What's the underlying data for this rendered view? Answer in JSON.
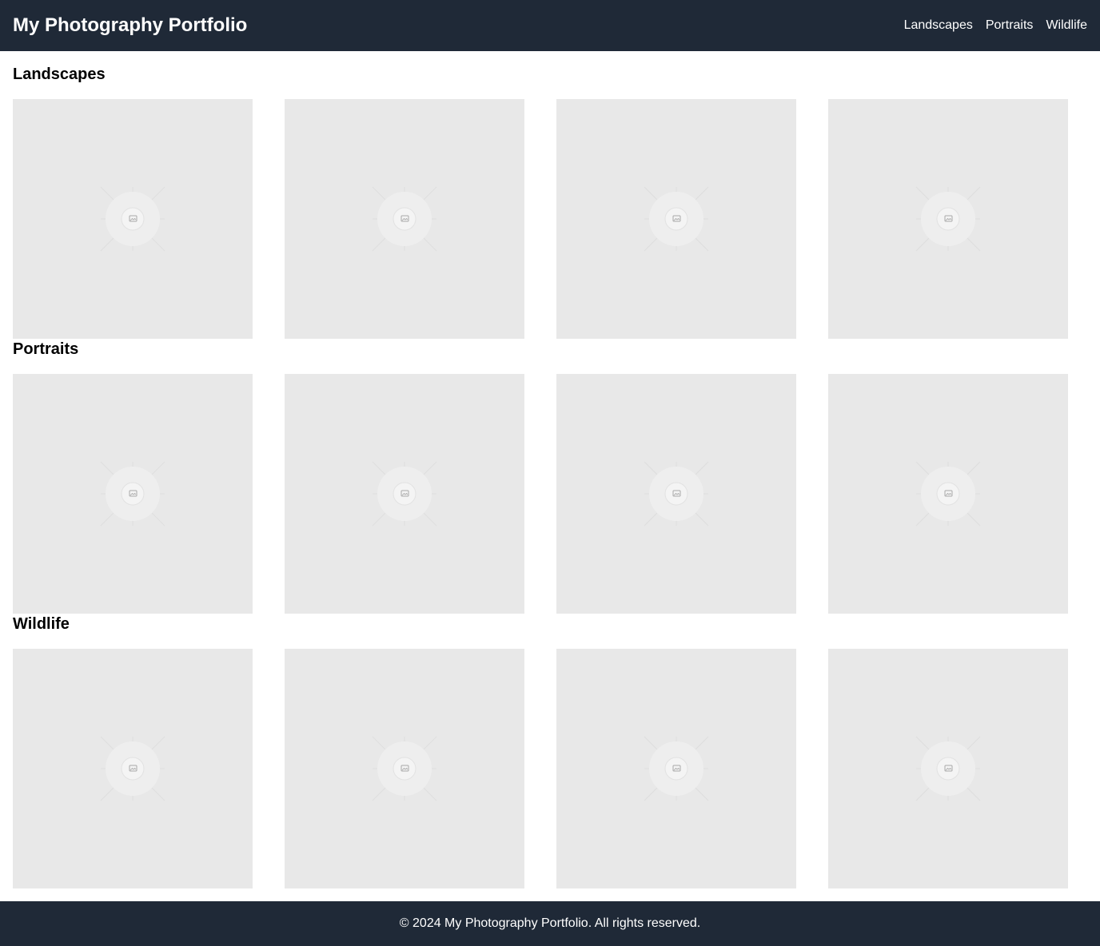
{
  "header": {
    "title": "My Photography Portfolio",
    "nav": [
      "Landscapes",
      "Portraits",
      "Wildlife"
    ]
  },
  "sections": [
    {
      "title": "Landscapes",
      "photo_count": 4
    },
    {
      "title": "Portraits",
      "photo_count": 4
    },
    {
      "title": "Wildlife",
      "photo_count": 4
    }
  ],
  "icons": {
    "photo_placeholder": "image-placeholder-icon"
  },
  "colors": {
    "header_bg": "#1f2937",
    "placeholder_bg": "#e8e8e8",
    "text_light": "#ffffff"
  },
  "footer": {
    "text": "© 2024 My Photography Portfolio. All rights reserved."
  }
}
